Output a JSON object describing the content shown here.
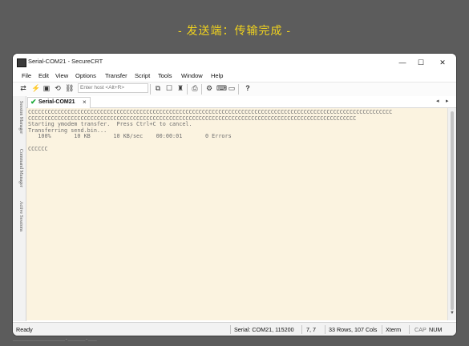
{
  "banner": "- 发送端：传输完成 -",
  "window": {
    "title": "Serial-COM21 - SecureCRT",
    "controls": [
      "—",
      "☐",
      "✕"
    ]
  },
  "menu": [
    "File",
    "Edit",
    "View",
    "Options",
    "Transfer",
    "Script",
    "Tools",
    "Window",
    "Help"
  ],
  "toolbar": {
    "host_placeholder": "Enter host <Alt+R>"
  },
  "sidebar_tabs": [
    "Session Manager",
    "Command Manager",
    "Active Sessions"
  ],
  "tab": {
    "label": "Serial-COM21",
    "close": "×",
    "prev": "◂",
    "next": "▸"
  },
  "terminal": {
    "lines": [
      "CCCCCCCCCCCCCCCCCCCCCCCCCCCCCCCCCCCCCCCCCCCCCCCCCCCCCCCCCCCCCCCCCCCCCCCCCCCCCCCCCCCCCCCCCCCCCCCCCCCCCCCCCCCCCCC",
      "CCCCCCCCCCCCCCCCCCCCCCCCCCCCCCCCCCCCCCCCCCCCCCCCCCCCCCCCCCCCCCCCCCCCCCCCCCCCCCCCCCCCCCCCCCCCCCCCCCCC",
      "Starting ymodem transfer.  Press Ctrl+C to cancel.",
      "Transferring send.bin...",
      "   100%       10 KB       10 KB/sec    00:00:01       0 Errors",
      "",
      "CCCCCC"
    ]
  },
  "status": {
    "ready": "Ready",
    "connection": "Serial: COM21, 115200",
    "cursor": "7,  7",
    "dims": "33 Rows, 107 Cols",
    "term": "Xterm",
    "cap": "CAP",
    "num": "NUM"
  },
  "background_strip": "__________________.______.___"
}
